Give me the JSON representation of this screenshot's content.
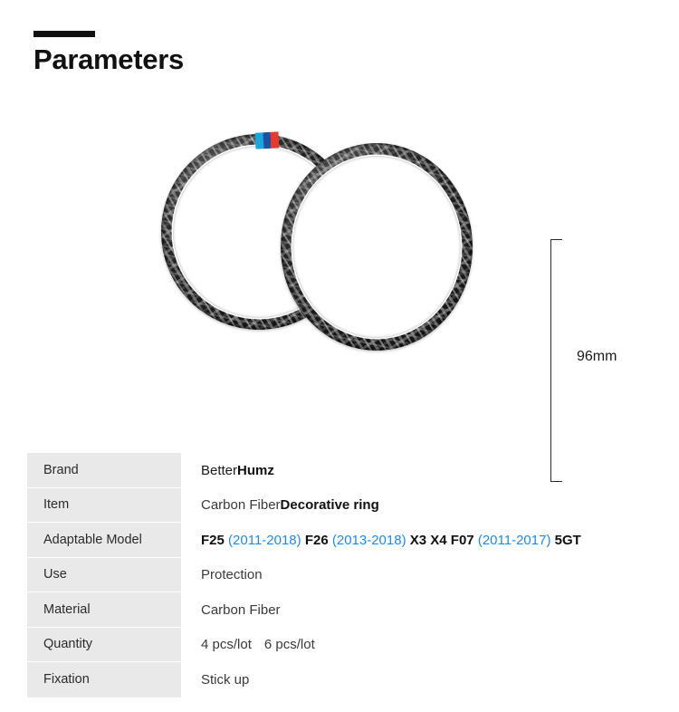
{
  "header": {
    "title": "Parameters",
    "accent_color": "#111111"
  },
  "product_image": {
    "alt_name": "carbon-fiber-decorative-rings",
    "ring_count": 2,
    "accent_stripes": [
      "#1aa7d8",
      "#1b4fa8",
      "#e8392c"
    ],
    "carbon_color": "#1d1d1d"
  },
  "dimension": {
    "label": "96mm",
    "orientation": "vertical"
  },
  "spec_table": {
    "rows": [
      {
        "label": "Brand",
        "value": "BetterHumz"
      },
      {
        "label": "Item",
        "value": "Carbon Fiber Decorative ring"
      },
      {
        "label": "Adaptable Model",
        "value": "F25 (2011-2018) F26 (2013-2018) X3 X4 F07 (2011-2017) 5GT"
      },
      {
        "label": "Use",
        "value": "Protection"
      },
      {
        "label": "Material",
        "value": "Carbon Fiber"
      },
      {
        "label": "Quantity",
        "value": "4 pcs/lot   6 pcs/lot"
      },
      {
        "label": "Fixation",
        "value": "Stick up"
      }
    ],
    "brand": {
      "prefix": "Better",
      "suffix": "Humz"
    },
    "item": {
      "prefix": "Carbon Fiber ",
      "suffix": "Decorative ring"
    },
    "adaptable": {
      "m1": "F25",
      "y1": "(2011-2018)",
      "m2": "F26",
      "y2": "(2013-2018)",
      "m3": "X3 X4 F07",
      "y3": "(2011-2017)",
      "m4": "5GT"
    },
    "quantity": {
      "first": "4 pcs/lot",
      "second": "6 pcs/lot"
    },
    "label_bg": "#e9e9e9",
    "year_color": "#1a8cf0"
  }
}
